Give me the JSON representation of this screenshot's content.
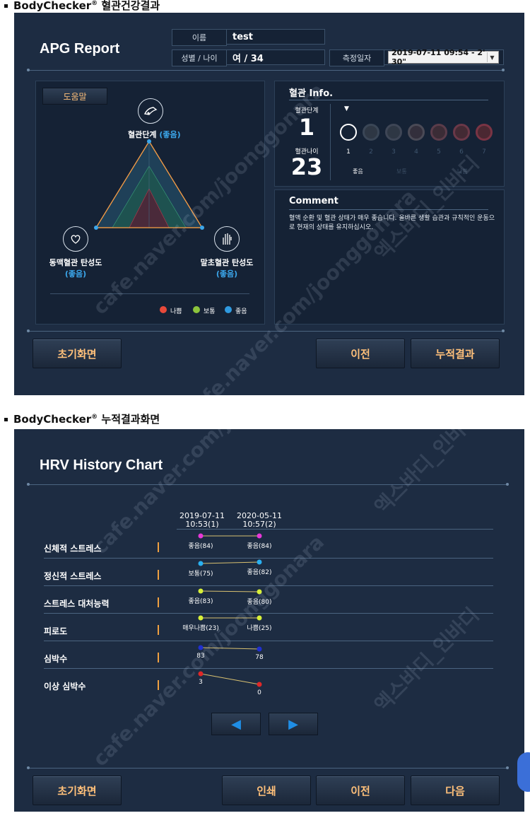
{
  "section1": {
    "brand": "BodyChecker",
    "mark": "®",
    "title": "혈관건강결과"
  },
  "section2": {
    "brand": "BodyChecker",
    "mark": "®",
    "title": "누적결과화면"
  },
  "apg": {
    "title": "APG Report",
    "name_label": "이름",
    "name_value": "test",
    "gender_age_label": "성별 / 나이",
    "gender_age_value": "여 / 34",
    "date_label": "측정일자",
    "date_value": "2019-07-11 09:54 - 2' 30\"",
    "help_button": "도움말",
    "radar": {
      "top_label": "혈관단계",
      "top_status": "(좋음)",
      "left_label": "동맥혈관 탄성도",
      "left_status": "(좋음)",
      "right_label": "말초혈관 탄성도",
      "right_status": "(좋음)"
    },
    "legend": [
      {
        "label": "나쁨",
        "color": "#e8493a"
      },
      {
        "label": "보통",
        "color": "#8cc43c"
      },
      {
        "label": "좋음",
        "color": "#2f9ae0"
      }
    ],
    "info": {
      "title": "혈관 Info.",
      "stage_label": "혈관단계",
      "stage_value": "1",
      "age_label": "혈관나이",
      "age_value": "23",
      "grades": [
        "1",
        "2",
        "3",
        "4",
        "5",
        "6",
        "7"
      ],
      "grade_status": [
        "좋음",
        "보통",
        "나쁨"
      ]
    },
    "comment": {
      "title": "Comment",
      "text": "혈액 순환 및 혈관 상태가 매우 좋습니다. 올바른 생활 습관과 규칙적인 운동으로 현재의 상태를 유지하십시오."
    },
    "buttons": {
      "home": "초기화면",
      "prev": "이전",
      "cumulative": "누적결과"
    }
  },
  "hrv": {
    "title": "HRV History Chart",
    "dates": [
      {
        "date": "2019-07-11",
        "time": "10:53(1)"
      },
      {
        "date": "2020-05-11",
        "time": "10:57(2)"
      }
    ],
    "rows": [
      {
        "label": "신체적 스트레스",
        "v1": "좋음(84)",
        "v2": "좋음(84)",
        "color": "#e838d8"
      },
      {
        "label": "정신적 스트레스",
        "v1": "보통(75)",
        "v2": "좋음(82)",
        "color": "#2ab0f0"
      },
      {
        "label": "스트레스 대처능력",
        "v1": "좋음(83)",
        "v2": "좋음(80)",
        "color": "#d8f038"
      },
      {
        "label": "피로도",
        "v1": "매우나쁨(23)",
        "v2": "나쁨(25)",
        "color": "#d8f038"
      },
      {
        "label": "심박수",
        "v1": "83",
        "v2": "78",
        "color": "#2030d0"
      },
      {
        "label": "이상 심박수",
        "v1": "3",
        "v2": "0",
        "color": "#e02828"
      }
    ],
    "buttons": {
      "home": "초기화면",
      "print": "인쇄",
      "prev": "이전",
      "next": "다음"
    }
  },
  "watermarks": [
    "cafe.naver.com/joonggonara",
    "엑스바디_인바디"
  ]
}
